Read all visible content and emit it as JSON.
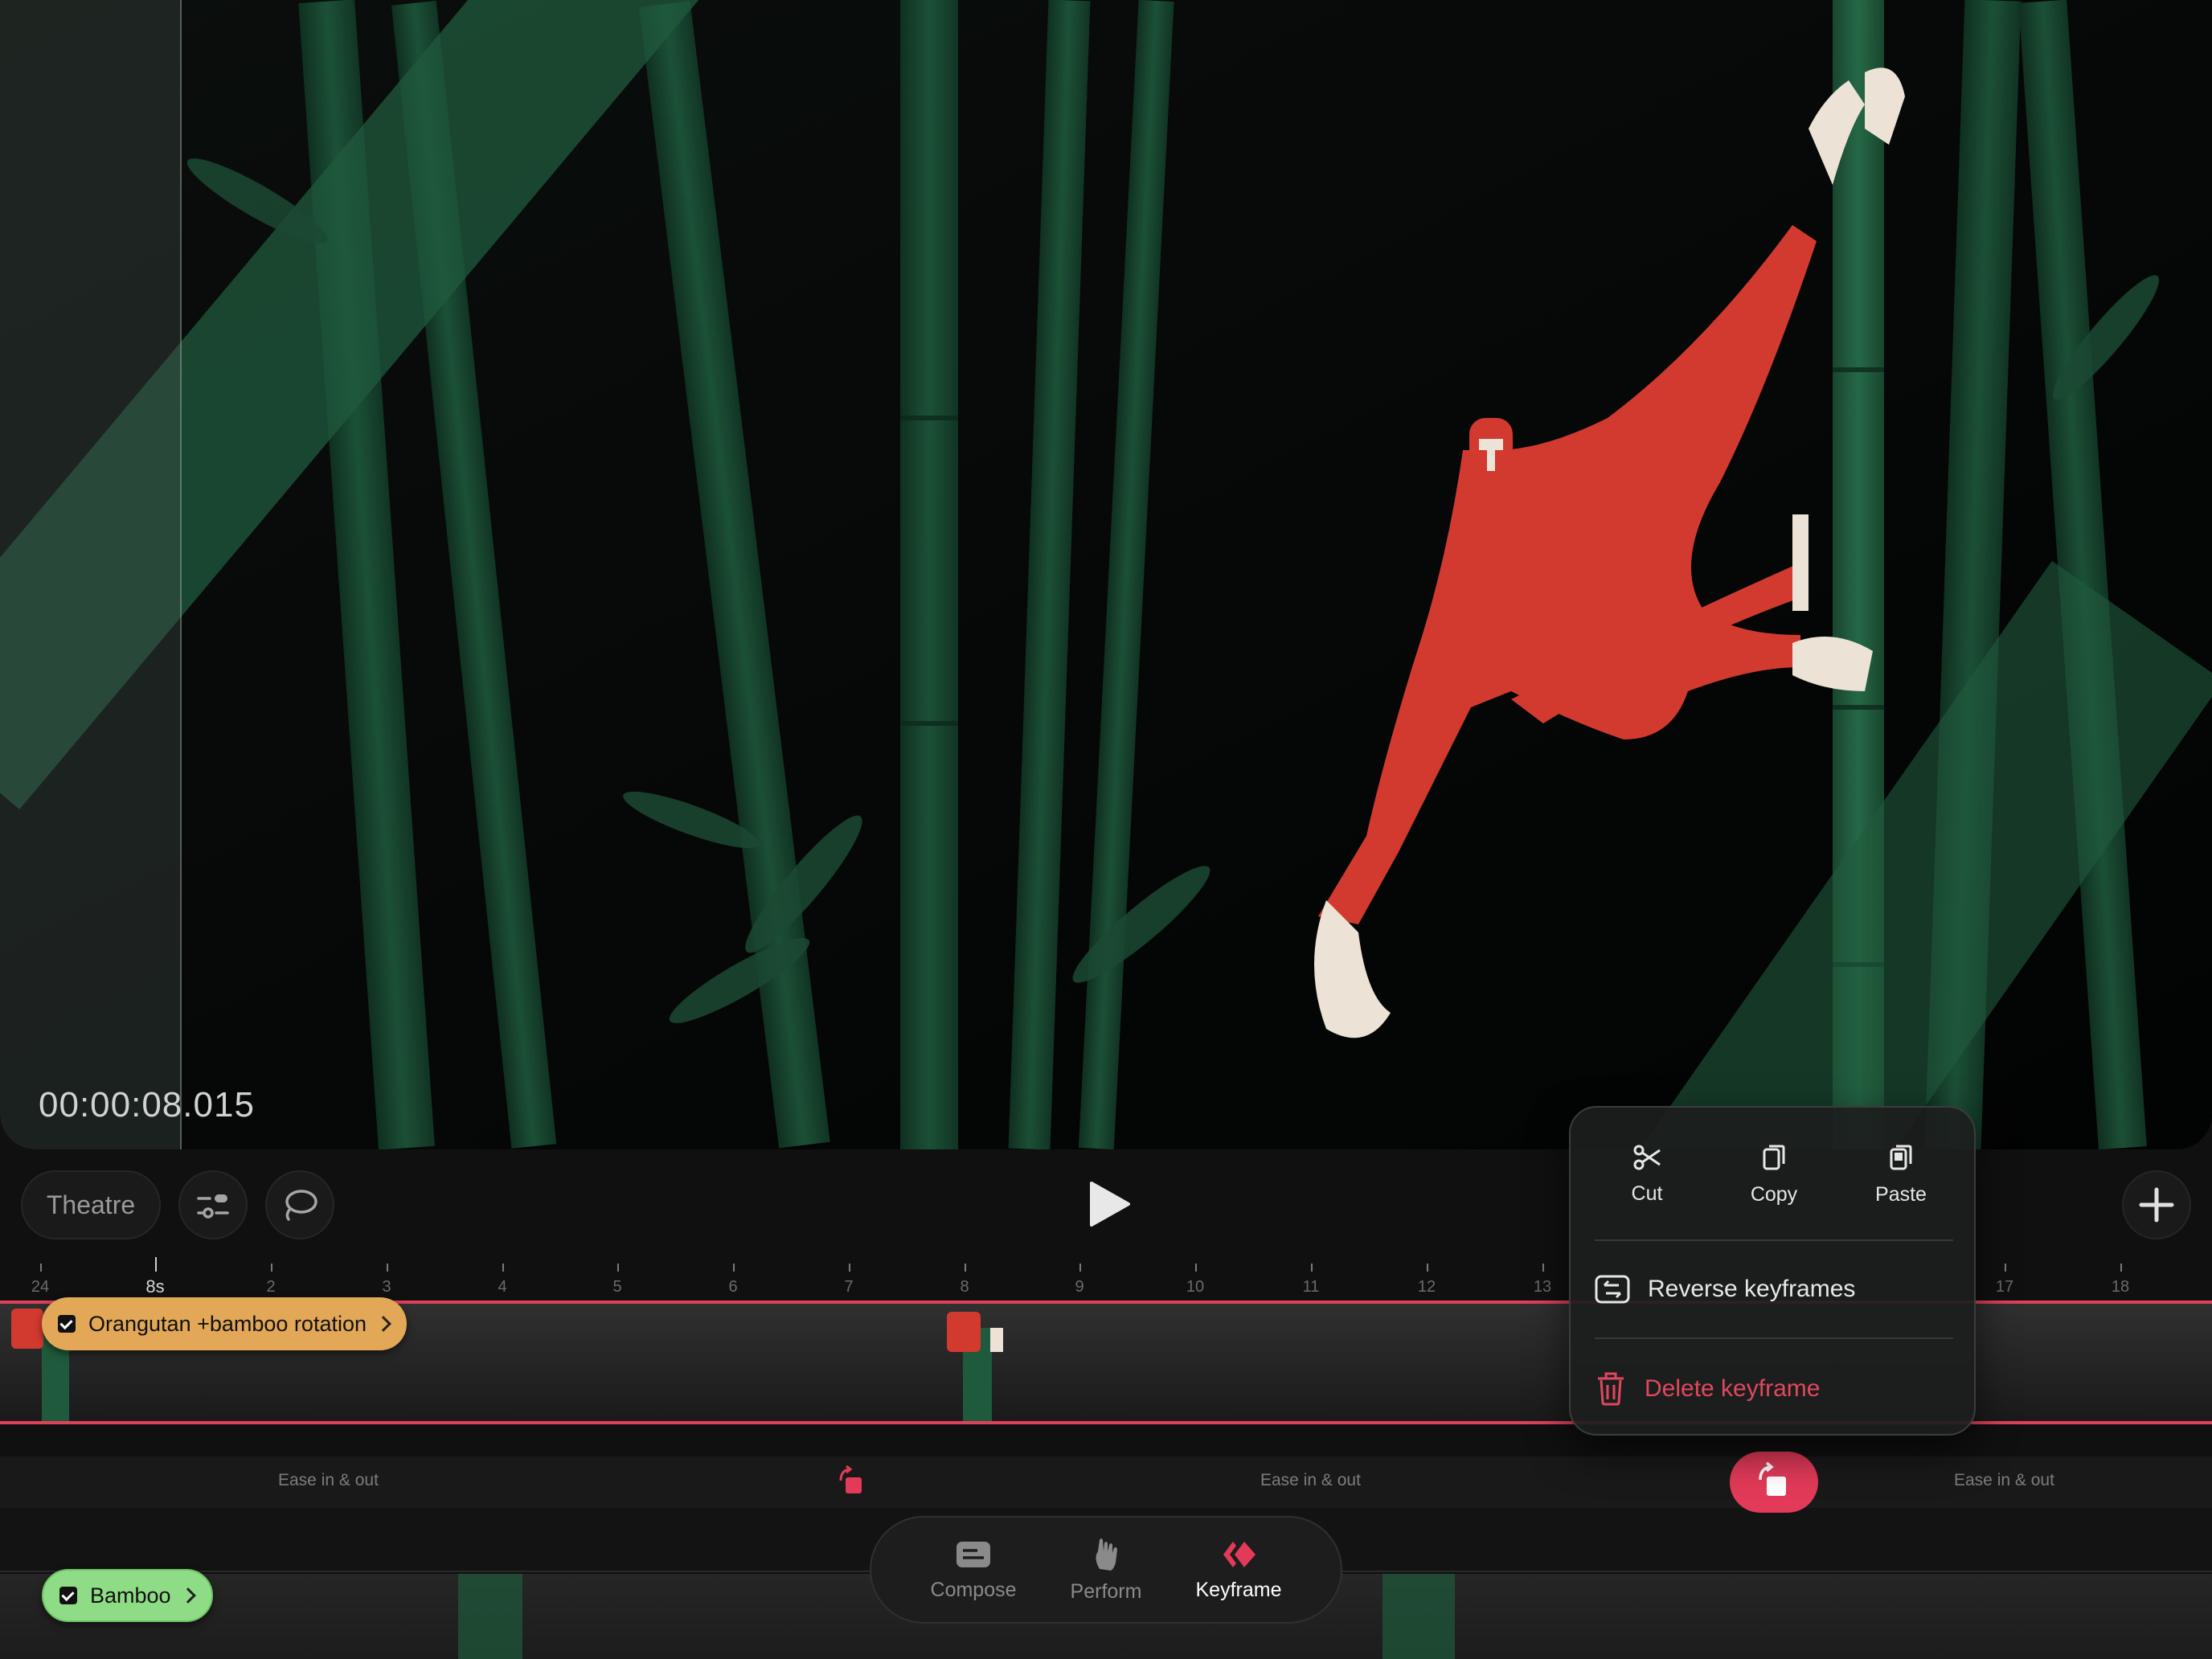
{
  "stage": {
    "timecode": "00:00:08.015"
  },
  "controls": {
    "view_mode_label": "Theatre",
    "filter_icon": "sliders-icon",
    "lasso_icon": "lasso-icon",
    "play_icon": "play-icon",
    "add_icon": "plus-icon"
  },
  "ruler": {
    "playhead_label": "8s",
    "ticks": [
      "24",
      "2",
      "3",
      "4",
      "5",
      "6",
      "7",
      "8",
      "9",
      "10",
      "11",
      "12",
      "13",
      "17",
      "18"
    ]
  },
  "tracks": {
    "orangutan": {
      "label": "Orangutan +bamboo rotation",
      "checked": true
    },
    "bamboo": {
      "label": "Bamboo",
      "checked": true
    },
    "ease": [
      "Ease in & out",
      "Ease in & out",
      "Ease in & out"
    ]
  },
  "modes": {
    "items": [
      {
        "label": "Compose",
        "icon": "compose-icon"
      },
      {
        "label": "Perform",
        "icon": "hand-icon"
      },
      {
        "label": "Keyframe",
        "icon": "keyframe-icon"
      }
    ],
    "active": "Keyframe"
  },
  "context_menu": {
    "cut": "Cut",
    "copy": "Copy",
    "paste": "Paste",
    "reverse": "Reverse keyframes",
    "delete": "Delete keyframe"
  },
  "colors": {
    "accent": "#e23a58",
    "orangutan_track": "#e2a757",
    "bamboo_track": "#8fdc86",
    "bamboo_green": "#1f5a3c",
    "orangutan_red": "#d23a30"
  }
}
